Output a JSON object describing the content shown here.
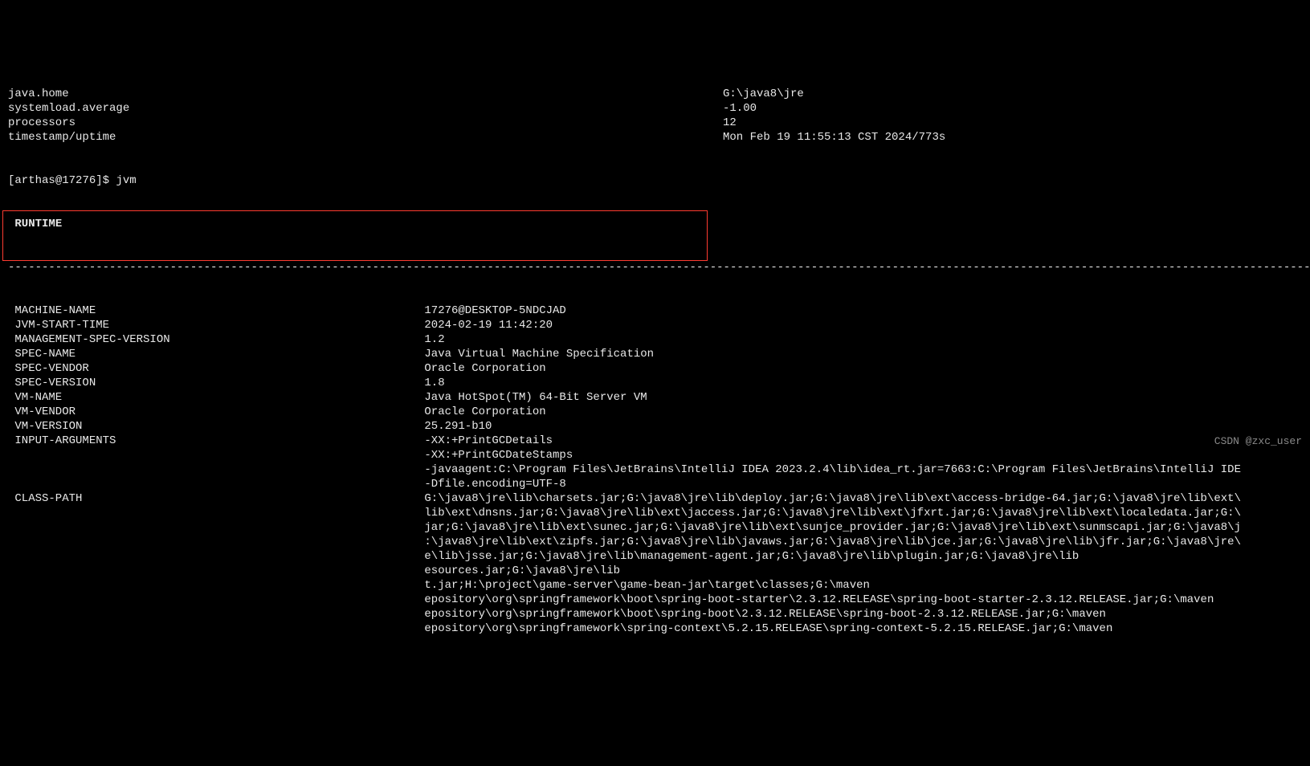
{
  "top": {
    "rows": [
      {
        "k": "java.home",
        "v": "G:\\java8\\jre"
      },
      {
        "k": "systemload.average",
        "v": "-1.00"
      },
      {
        "k": "processors",
        "v": "12"
      },
      {
        "k": "timestamp/uptime",
        "v": "Mon Feb 19 11:55:13 CST 2024/773s"
      }
    ]
  },
  "prompt": {
    "user": "arthas",
    "pid": "17276",
    "cmd": "jvm"
  },
  "section_title": "RUNTIME",
  "divider": "-",
  "runtime": {
    "rows": [
      {
        "k": "MACHINE-NAME",
        "v": "17276@DESKTOP-5NDCJAD"
      },
      {
        "k": "JVM-START-TIME",
        "v": "2024-02-19 11:42:20"
      },
      {
        "k": "MANAGEMENT-SPEC-VERSION",
        "v": "1.2"
      },
      {
        "k": "SPEC-NAME",
        "v": "Java Virtual Machine Specification"
      },
      {
        "k": "SPEC-VENDOR",
        "v": "Oracle Corporation"
      },
      {
        "k": "SPEC-VERSION",
        "v": "1.8"
      },
      {
        "k": "VM-NAME",
        "v": "Java HotSpot(TM) 64-Bit Server VM"
      },
      {
        "k": "VM-VENDOR",
        "v": "Oracle Corporation"
      },
      {
        "k": "VM-VERSION",
        "v": "25.291-b10"
      },
      {
        "k": "INPUT-ARGUMENTS",
        "v": "-XX:+PrintGCDetails"
      },
      {
        "k": "",
        "v": "-XX:+PrintGCDateStamps"
      },
      {
        "k": "",
        "v": "-javaagent:C:\\Program Files\\JetBrains\\IntelliJ IDEA 2023.2.4\\lib\\idea_rt.jar=7663:C:\\Program Files\\JetBrains\\IntelliJ IDE"
      },
      {
        "k": "",
        "v": "-Dfile.encoding=UTF-8"
      },
      {
        "k": "CLASS-PATH",
        "v": "G:\\java8\\jre\\lib\\charsets.jar;G:\\java8\\jre\\lib\\deploy.jar;G:\\java8\\jre\\lib\\ext\\access-bridge-64.jar;G:\\java8\\jre\\lib\\ext\\"
      },
      {
        "k": "",
        "v": "lib\\ext\\dnsns.jar;G:\\java8\\jre\\lib\\ext\\jaccess.jar;G:\\java8\\jre\\lib\\ext\\jfxrt.jar;G:\\java8\\jre\\lib\\ext\\localedata.jar;G:\\"
      },
      {
        "k": "",
        "v": "jar;G:\\java8\\jre\\lib\\ext\\sunec.jar;G:\\java8\\jre\\lib\\ext\\sunjce_provider.jar;G:\\java8\\jre\\lib\\ext\\sunmscapi.jar;G:\\java8\\j"
      },
      {
        "k": "",
        "v": ":\\java8\\jre\\lib\\ext\\zipfs.jar;G:\\java8\\jre\\lib\\javaws.jar;G:\\java8\\jre\\lib\\jce.jar;G:\\java8\\jre\\lib\\jfr.jar;G:\\java8\\jre\\"
      },
      {
        "k": "",
        "v": "e\\lib\\jsse.jar;G:\\java8\\jre\\lib\\management-agent.jar;G:\\java8\\jre\\lib\\plugin.jar;G:\\java8\\jre\\lib"
      },
      {
        "k": "",
        "v": "esources.jar;G:\\java8\\jre\\lib"
      },
      {
        "k": "",
        "v": "t.jar;H:\\project\\game-server\\game-bean-jar\\target\\classes;G:\\maven"
      },
      {
        "k": "",
        "v": "epository\\org\\springframework\\boot\\spring-boot-starter\\2.3.12.RELEASE\\spring-boot-starter-2.3.12.RELEASE.jar;G:\\maven"
      },
      {
        "k": "",
        "v": "epository\\org\\springframework\\boot\\spring-boot\\2.3.12.RELEASE\\spring-boot-2.3.12.RELEASE.jar;G:\\maven"
      },
      {
        "k": "",
        "v": "epository\\org\\springframework\\spring-context\\5.2.15.RELEASE\\spring-context-5.2.15.RELEASE.jar;G:\\maven"
      }
    ]
  },
  "watermark": "CSDN @zxc_user",
  "highlight_region": "VM-VERSION / INPUT-ARGUMENTS"
}
